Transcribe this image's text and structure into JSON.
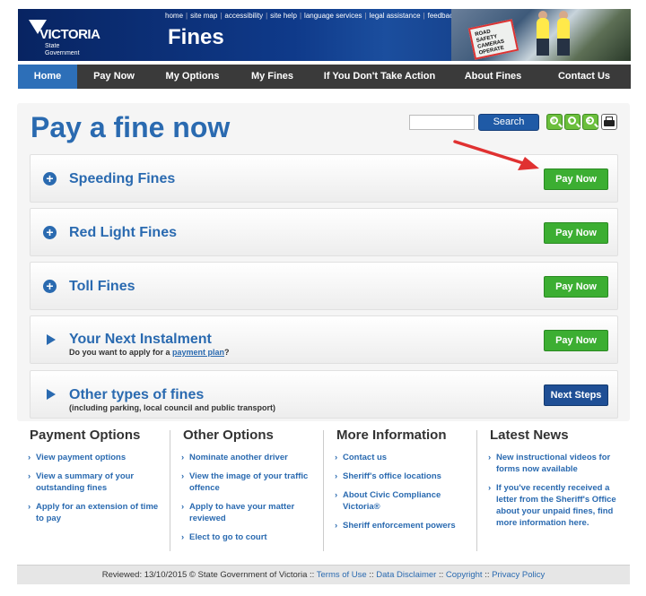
{
  "header": {
    "logo_name": "VICTORIA",
    "logo_sub_1": "State",
    "logo_sub_2": "Government",
    "site_title": "Fines",
    "utility_links": [
      "home",
      "site map",
      "accessibility",
      "site help",
      "language services",
      "legal assistance",
      "feedback"
    ],
    "photo_sign": "ROAD SAFETY CAMERAS OPERATE"
  },
  "nav": [
    "Home",
    "Pay Now",
    "My Options",
    "My Fines",
    "If You Don't Take Action",
    "About Fines",
    "Contact Us"
  ],
  "page_title": "Pay a fine now",
  "search": {
    "button": "Search",
    "value": ""
  },
  "rows": [
    {
      "title": "Speeding Fines",
      "button": "Pay Now"
    },
    {
      "title": "Red Light Fines",
      "button": "Pay Now"
    },
    {
      "title": "Toll Fines",
      "button": "Pay Now"
    },
    {
      "title": "Your Next Instalment",
      "sub_prefix": "Do you want to apply for a ",
      "sub_link": "payment plan",
      "sub_suffix": "?",
      "button": "Pay Now"
    },
    {
      "title": "Other types of fines",
      "sub": "(including parking, local council and public transport)",
      "button": "Next Steps"
    }
  ],
  "columns": [
    {
      "title": "Payment Options",
      "items": [
        "View payment options",
        "View a summary of your outstanding fines",
        "Apply for an extension of time to pay"
      ]
    },
    {
      "title": "Other Options",
      "items": [
        "Nominate another driver",
        "View the image of your traffic offence",
        "Apply to have your matter reviewed",
        "Elect to go to court"
      ]
    },
    {
      "title": "More Information",
      "items": [
        "Contact us",
        "Sheriff's office locations",
        "About Civic Compliance Victoria®",
        "Sheriff enforcement powers"
      ]
    },
    {
      "title": "Latest News",
      "items": [
        "New instructional videos for forms now available",
        "If you've recently received a letter from the Sheriff's Office about your unpaid fines, find more information here."
      ]
    }
  ],
  "footer": {
    "reviewed": "Reviewed: 13/10/2015 © State Government of Victoria ::",
    "links": [
      "Terms of Use",
      "Data Disclaimer",
      "Copyright",
      "Privacy Policy"
    ]
  },
  "colors": {
    "brand_blue": "#2a6ab0",
    "nav_bg": "#3a3a3a",
    "pay_green": "#3cae32",
    "next_blue": "#1f4f95",
    "arrow_red": "#e03131"
  }
}
